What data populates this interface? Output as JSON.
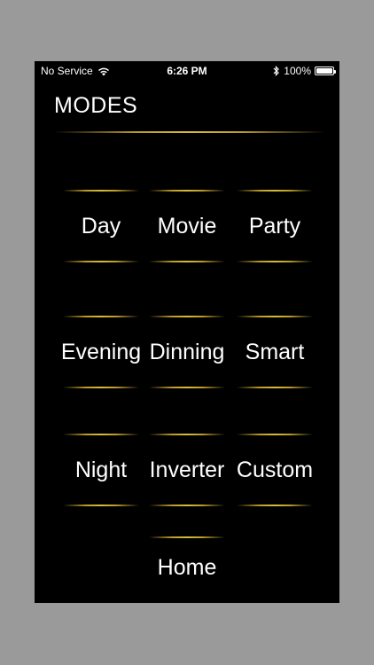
{
  "status_bar": {
    "carrier": "No Service",
    "time": "6:26 PM",
    "battery": "100%",
    "battery_level": 1.0
  },
  "title": "MODES",
  "modes": [
    {
      "label": "Day"
    },
    {
      "label": "Movie"
    },
    {
      "label": "Party"
    },
    {
      "label": "Evening"
    },
    {
      "label": "Dinning"
    },
    {
      "label": "Smart"
    },
    {
      "label": "Night"
    },
    {
      "label": "Inverter"
    },
    {
      "label": "Custom"
    }
  ],
  "home": {
    "label": "Home"
  },
  "colors": {
    "background": "#000000",
    "accent_line": "#d8bb3a",
    "text": "#ffffff",
    "frame": "#9a9a9a"
  }
}
